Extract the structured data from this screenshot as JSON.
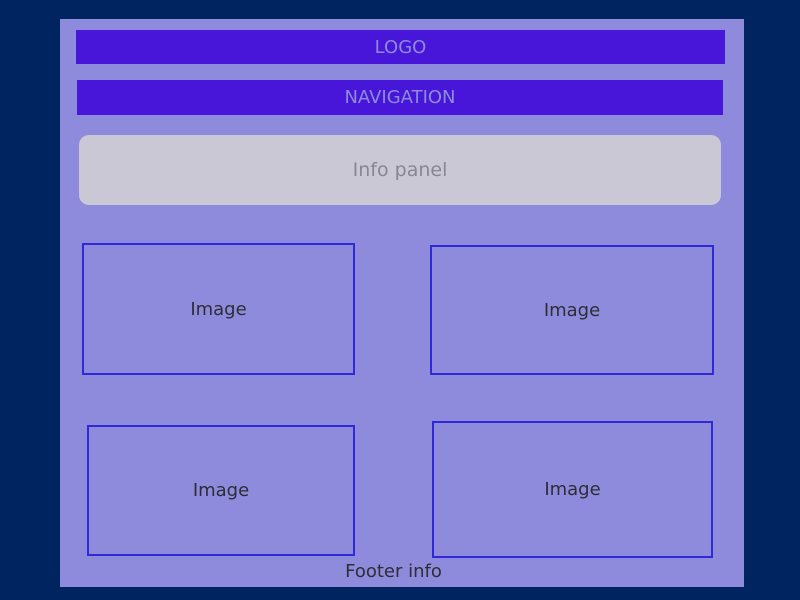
{
  "header": {
    "logo_label": "LOGO",
    "navigation_label": "NAVIGATION"
  },
  "info_panel": {
    "label": "Info panel"
  },
  "images": [
    {
      "label": "Image"
    },
    {
      "label": "Image"
    },
    {
      "label": "Image"
    },
    {
      "label": "Image"
    }
  ],
  "footer": {
    "label": "Footer info"
  },
  "colors": {
    "page_background": "#00245f",
    "canvas_background": "#8e8bdc",
    "bar_fill": "#4716d8",
    "info_panel_fill": "#cbc8d6",
    "image_border": "#3129d7"
  }
}
